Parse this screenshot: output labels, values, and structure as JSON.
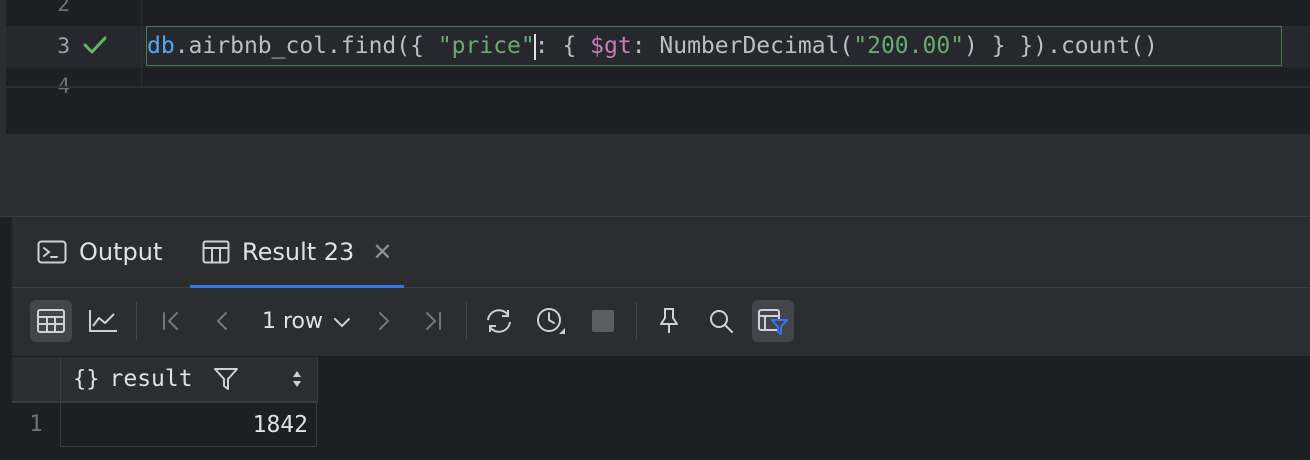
{
  "editor": {
    "line_numbers": [
      "2",
      "3",
      "4"
    ],
    "code": {
      "t1": "db",
      "t2": ".airbnb_col.find({ ",
      "t3": "\"price\"",
      "t4": ": { ",
      "t5": "$gt",
      "t6": ": NumberDecimal(",
      "t7": "\"200.00\"",
      "t8": ") } }).count()"
    },
    "run_status": "success"
  },
  "panel": {
    "tabs": [
      {
        "label": "Output",
        "icon": "console-icon"
      },
      {
        "label": "Result 23",
        "icon": "table-icon",
        "active": true
      }
    ],
    "toolbar": {
      "rows_label": "1 row"
    },
    "grid": {
      "columns": [
        {
          "icon": "{}",
          "label": "result"
        }
      ],
      "rows": [
        {
          "num": "1",
          "values": [
            "1842"
          ]
        }
      ]
    }
  },
  "colors": {
    "accent": "#3574f0",
    "success": "#5fb865",
    "string": "#6aab73",
    "keyword_db": "#56a8f5",
    "operator": "#c77dbb"
  }
}
